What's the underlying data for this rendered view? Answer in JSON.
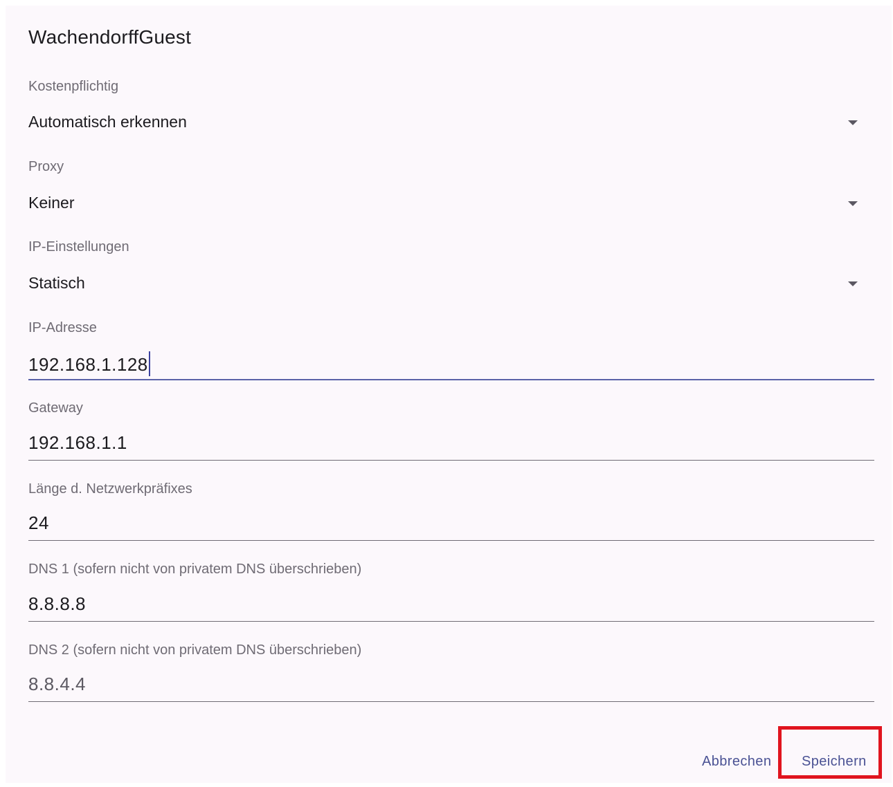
{
  "dialog": {
    "title": "WachendorffGuest"
  },
  "metered": {
    "label": "Kostenpflichtig",
    "value": "Automatisch erkennen"
  },
  "proxy": {
    "label": "Proxy",
    "value": "Keiner"
  },
  "ip_settings": {
    "label": "IP-Einstellungen",
    "value": "Statisch"
  },
  "ip_address": {
    "label": "IP-Adresse",
    "value": "192.168.1.128"
  },
  "gateway": {
    "label": "Gateway",
    "value": "192.168.1.1"
  },
  "prefix_length": {
    "label": "Länge d. Netzwerkpräfixes",
    "value": "24"
  },
  "dns1": {
    "label": "DNS 1 (sofern nicht von privatem DNS überschrieben)",
    "value": "8.8.8.8"
  },
  "dns2": {
    "label": "DNS 2 (sofern nicht von privatem DNS überschrieben)",
    "value": "8.8.4.4"
  },
  "actions": {
    "cancel_label": "Abbrechen",
    "save_label": "Speichern"
  },
  "icons": {
    "dropdown": "chevron-down-icon"
  },
  "colors": {
    "accent": "#4a5294",
    "highlight": "#e0141e",
    "background": "#fcf8fc"
  }
}
